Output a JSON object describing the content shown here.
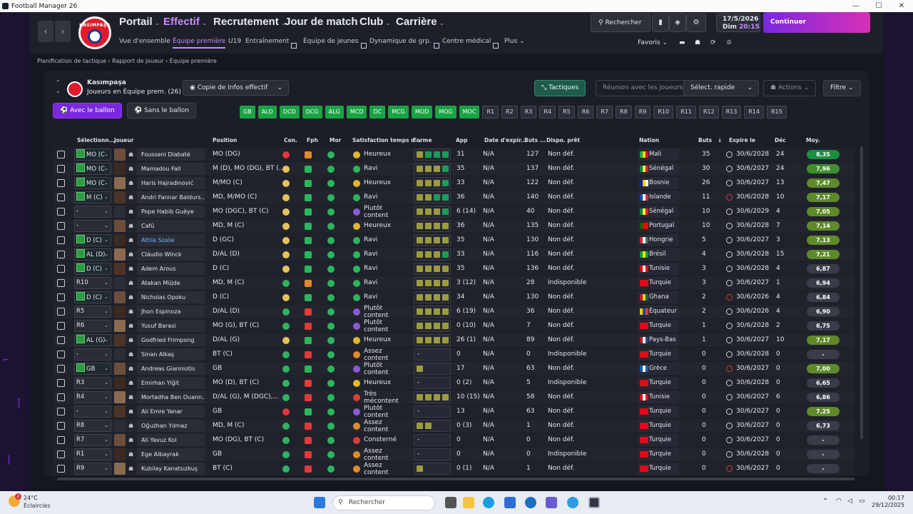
{
  "window": {
    "title": "Football Manager 26",
    "minimize": "—",
    "maximize": "☐",
    "close": "✕"
  },
  "nav": {
    "club": "KASIMPAŞA",
    "main": [
      {
        "label": "Portail",
        "active": false
      },
      {
        "label": "Effectif",
        "active": true
      },
      {
        "label": "Recrutement",
        "active": false
      },
      {
        "label": "Jour de match",
        "active": false
      },
      {
        "label": "Club",
        "active": false
      },
      {
        "label": "Carrière",
        "active": false
      }
    ],
    "sub": [
      "Vue d'ensemble",
      "Équipe première",
      "U19",
      "Entraînement",
      "Équipe de jeunes",
      "Dynamique de grp.",
      "Centre médical",
      "Plus"
    ],
    "search": "Rechercher",
    "date": "17/5/2026",
    "day": "Dim",
    "time": "20:15",
    "continue": "Continuer",
    "favoris": "Favoris"
  },
  "breadcrumb": {
    "items": [
      "Planification de tactique",
      "Rapport de joueur",
      "Équipe première"
    ]
  },
  "panel": {
    "team": "Kasımpaşa",
    "sub": "Joueurs en Équipe prem. (26)",
    "view": "Copie de Infos effectif",
    "with_ball": "Avec le ballon",
    "without_ball": "Sans le ballon",
    "tactiques": "Tactiques",
    "reunion": "Réunion avec les joueurs",
    "select_rapide": "Sélect. rapide",
    "actions": "Actions",
    "filtre": "Filtre",
    "pos_tags": [
      "GB",
      "ALD",
      "DCD",
      "DCG",
      "ALG",
      "MCD",
      "DC",
      "MCG",
      "MOD",
      "MOG",
      "MOC"
    ],
    "res_tags": [
      "R1",
      "R2",
      "R3",
      "R4",
      "R5",
      "R6",
      "R7",
      "R8",
      "R9",
      "R10",
      "R11",
      "R12",
      "R13",
      "R14",
      "R15"
    ]
  },
  "table": {
    "headers": [
      "Sélectionn...",
      "Joueur",
      "Position",
      "Con.",
      "Fph",
      "Mor",
      "Satisfaction temps d...",
      "Forme",
      "App",
      "Date d'expir...",
      "Buts ...",
      "Dispo. prêt",
      "Nation",
      "Buts",
      "Expire le",
      "Déc",
      "Moy."
    ],
    "rows": [
      {
        "sel": "MO (C",
        "pitch": true,
        "name": "Fousseni Diabaté",
        "pos": "MO (DG)",
        "con": "#e03a3a",
        "fph": "#e08a2a",
        "sat": "Heureux",
        "satc": "#e0b72a",
        "form": "yggg",
        "app": "31",
        "exp": "N/A",
        "buts1": "127",
        "dispo": "Non déf.",
        "flag": [
          "#14b53a",
          "#fcd116",
          "#ce1126"
        ],
        "nation": "Mali",
        "buts": "35",
        "clk": "n",
        "expire": "30/6/2028",
        "dec": "24",
        "moy": "8,35",
        "moyc": "#1a8f42"
      },
      {
        "sel": "MO (C",
        "pitch": true,
        "name": "Mamadou Fall",
        "pos": "M (D), MO (DG), BT (...",
        "con": "#e6c25a",
        "fph": "#2db55d",
        "sat": "Ravi",
        "satc": "#2db55d",
        "form": "yyyg",
        "app": "35",
        "exp": "N/A",
        "buts1": "137",
        "dispo": "Non déf.",
        "flag": [
          "#00853f",
          "#fdef42",
          "#e31b23"
        ],
        "nation": "Sénégal",
        "buts": "30",
        "clk": "n",
        "expire": "30/6/2027",
        "dec": "24",
        "moy": "7,96",
        "moyc": "#3f8f2e"
      },
      {
        "sel": "MO (C",
        "pitch": true,
        "name": "Haris Hajradinović",
        "pos": "M/MO (C)",
        "con": "#e6c25a",
        "fph": "#2db55d",
        "sat": "Heureux",
        "satc": "#e0b72a",
        "form": "yyyg",
        "app": "33",
        "exp": "N/A",
        "buts1": "122",
        "dispo": "Non déf.",
        "flag": [
          "#002395",
          "#fecb00",
          "#ffffff"
        ],
        "nation": "Bosnie",
        "buts": "26",
        "clk": "n",
        "expire": "30/6/2027",
        "dec": "13",
        "moy": "7,47",
        "moyc": "#5f8a2a"
      },
      {
        "sel": "M (C)",
        "pitch": true,
        "name": "Andri Fannar Baldurs...",
        "pos": "MD, M/MO (C)",
        "con": "#e6c25a",
        "fph": "#2db55d",
        "sat": "Ravi",
        "satc": "#2db55d",
        "form": "yygg",
        "app": "36",
        "exp": "N/A",
        "buts1": "140",
        "dispo": "Non déf.",
        "flag": [
          "#02529c",
          "#ffffff",
          "#dc1e35"
        ],
        "nation": "Islande",
        "buts": "11",
        "clk": "r",
        "expire": "30/6/2028",
        "dec": "10",
        "moy": "7,17",
        "moyc": "#5f8a2a"
      },
      {
        "sel": "-",
        "pitch": false,
        "name": "Pope Habib Guèye",
        "pos": "MO (DGC), BT (C)",
        "con": "#e6c25a",
        "fph": "#2db55d",
        "sat": "Plutôt content",
        "satc": "#8a5ad6",
        "form": "yyyg",
        "app": "6 (14)",
        "exp": "N/A",
        "buts1": "40",
        "dispo": "Non déf.",
        "flag": [
          "#00853f",
          "#fdef42",
          "#e31b23"
        ],
        "nation": "Sénégal",
        "buts": "10",
        "clk": "n",
        "expire": "30/6/2029",
        "dec": "4",
        "moy": "7,05",
        "moyc": "#5f8a2a"
      },
      {
        "sel": "-",
        "pitch": false,
        "name": "Cafú",
        "pos": "MD, M (C)",
        "con": "#e6c25a",
        "fph": "#2db55d",
        "sat": "Heureux",
        "satc": "#e0b72a",
        "form": "yyyy",
        "app": "36",
        "exp": "N/A",
        "buts1": "135",
        "dispo": "Non déf.",
        "flag": [
          "#006600",
          "#ff0000",
          "#ff0000"
        ],
        "nation": "Portugal",
        "buts": "10",
        "clk": "n",
        "expire": "30/6/2028",
        "dec": "7",
        "moy": "7,14",
        "moyc": "#5f8a2a"
      },
      {
        "sel": "D (C)",
        "pitch": true,
        "name": "Attila Szalai",
        "pos": "D (GC)",
        "link": true,
        "con": "#e6c25a",
        "fph": "#2db55d",
        "sat": "Ravi",
        "satc": "#2db55d",
        "form": "yyyy",
        "app": "35",
        "exp": "N/A",
        "buts1": "130",
        "dispo": "Non déf.",
        "flag": [
          "#cd2a3e",
          "#ffffff",
          "#436f4d"
        ],
        "nation": "Hongrie",
        "buts": "5",
        "clk": "n",
        "expire": "30/6/2027",
        "dec": "3",
        "moy": "7,13",
        "moyc": "#5f8a2a"
      },
      {
        "sel": "AL (D)",
        "pitch": true,
        "name": "Cláudio Winck",
        "pos": "D/AL (D)",
        "con": "#e6c25a",
        "fph": "#2db55d",
        "sat": "Ravi",
        "satc": "#2db55d",
        "form": "yyyg",
        "app": "33",
        "exp": "N/A",
        "buts1": "116",
        "dispo": "Non déf.",
        "flag": [
          "#009c3b",
          "#ffdf00",
          "#009c3b"
        ],
        "nation": "Brésil",
        "buts": "4",
        "clk": "n",
        "expire": "30/6/2028",
        "dec": "15",
        "moy": "7,21",
        "moyc": "#5f8a2a"
      },
      {
        "sel": "D (C)",
        "pitch": true,
        "name": "Adem Arous",
        "pos": "D (C)",
        "con": "#e6c25a",
        "fph": "#2db55d",
        "sat": "Ravi",
        "satc": "#2db55d",
        "form": "yyyy",
        "app": "35",
        "exp": "N/A",
        "buts1": "136",
        "dispo": "Non déf.",
        "flag": [
          "#e70013",
          "#ffffff",
          "#e70013"
        ],
        "nation": "Tunisie",
        "buts": "3",
        "clk": "n",
        "expire": "30/6/2028",
        "dec": "4",
        "moy": "6,87",
        "moyc": "#3a3d48"
      },
      {
        "sel": "R10",
        "pitch": false,
        "name": "Atakan Müjde",
        "pos": "MD, M (C)",
        "con": "#2db55d",
        "fph": "#e08a2a",
        "sat": "Ravi",
        "satc": "#2db55d",
        "form": "yyyy",
        "app": "3 (12)",
        "exp": "N/A",
        "buts1": "28",
        "dispo": "Indisponible",
        "flag": [
          "#e30a17",
          "#e30a17",
          "#e30a17"
        ],
        "nation": "Turquie",
        "buts": "3",
        "clk": "n",
        "expire": "30/6/2027",
        "dec": "1",
        "moy": "6,94",
        "moyc": "#3a3d48"
      },
      {
        "sel": "D (C)",
        "pitch": true,
        "name": "Nicholas Opoku",
        "pos": "D (C)",
        "con": "#e6c25a",
        "fph": "#2db55d",
        "sat": "Ravi",
        "satc": "#2db55d",
        "form": "yyyy",
        "app": "34",
        "exp": "N/A",
        "buts1": "130",
        "dispo": "Non déf.",
        "flag": [
          "#ce1126",
          "#fcd116",
          "#006b3f"
        ],
        "nation": "Ghana",
        "buts": "2",
        "clk": "r",
        "expire": "30/6/2026",
        "dec": "4",
        "moy": "6,84",
        "moyc": "#3a3d48"
      },
      {
        "sel": "R5",
        "pitch": false,
        "name": "Jhon Espinoza",
        "pos": "D/AL (D)",
        "con": "#2db55d",
        "fph": "#e03a3a",
        "sat": "Plutôt content",
        "satc": "#8a5ad6",
        "form": "yyyy",
        "app": "6 (19)",
        "exp": "N/A",
        "buts1": "36",
        "dispo": "Non déf.",
        "flag": [
          "#ffd100",
          "#034ea2",
          "#ef3340"
        ],
        "nation": "Équateur",
        "buts": "2",
        "clk": "n",
        "expire": "30/6/2026",
        "dec": "4",
        "moy": "6,90",
        "moyc": "#3a3d48"
      },
      {
        "sel": "R6",
        "pitch": false,
        "name": "Yusuf Barasi",
        "pos": "MO (G), BT (C)",
        "con": "#2db55d",
        "fph": "#e03a3a",
        "sat": "Plutôt content",
        "satc": "#8a5ad6",
        "form": "yyyy",
        "app": "0 (10)",
        "exp": "N/A",
        "buts1": "7",
        "dispo": "Non déf.",
        "flag": [
          "#e30a17",
          "#e30a17",
          "#e30a17"
        ],
        "nation": "Turquie",
        "buts": "1",
        "clk": "n",
        "expire": "30/6/2028",
        "dec": "2",
        "moy": "6,75",
        "moyc": "#3a3d48"
      },
      {
        "sel": "AL (G)",
        "pitch": true,
        "name": "Godfried Frimpong",
        "pos": "D/AL (G)",
        "con": "#e6c25a",
        "fph": "#2db55d",
        "sat": "Heureux",
        "satc": "#e0b72a",
        "form": "yyyy",
        "app": "26 (1)",
        "exp": "N/A",
        "buts1": "89",
        "dispo": "Non déf.",
        "flag": [
          "#ae1c28",
          "#ffffff",
          "#21468b"
        ],
        "nation": "Pays-Bas",
        "buts": "1",
        "clk": "n",
        "expire": "30/6/2027",
        "dec": "10",
        "moy": "7,17",
        "moyc": "#5f8a2a"
      },
      {
        "sel": "-",
        "pitch": false,
        "name": "Sinan Alkaş",
        "pos": "BT (C)",
        "con": "#2db55d",
        "fph": "#e03a3a",
        "sat": "Assez content",
        "satc": "#e08a2a",
        "form": "-",
        "app": "0",
        "exp": "N/A",
        "buts1": "0",
        "dispo": "Indisponible",
        "flag": [
          "#e30a17",
          "#e30a17",
          "#e30a17"
        ],
        "nation": "Turquie",
        "buts": "0",
        "clk": "n",
        "expire": "30/6/2028",
        "dec": "0",
        "moy": "-",
        "moyc": "#3a3d48"
      },
      {
        "sel": "GB",
        "pitch": true,
        "name": "Andreas Gianniotis",
        "pos": "GB",
        "con": "#2db55d",
        "fph": "#2db55d",
        "sat": "Plutôt content",
        "satc": "#8a5ad6",
        "form": "y",
        "app": "17",
        "exp": "N/A",
        "buts1": "63",
        "dispo": "Non déf.",
        "flag": [
          "#0d5eaf",
          "#ffffff",
          "#0d5eaf"
        ],
        "nation": "Grèce",
        "buts": "0",
        "clk": "r",
        "expire": "30/6/2027",
        "dec": "0",
        "moy": "7,00",
        "moyc": "#5f8a2a"
      },
      {
        "sel": "R3",
        "pitch": false,
        "name": "Emirhan Yiğit",
        "pos": "MO (D), BT (C)",
        "con": "#2db55d",
        "fph": "#e03a3a",
        "sat": "Heureux",
        "satc": "#e0b72a",
        "form": "-",
        "app": "0 (2)",
        "exp": "N/A",
        "buts1": "5",
        "dispo": "Indisponible",
        "flag": [
          "#e30a17",
          "#e30a17",
          "#e30a17"
        ],
        "nation": "Turquie",
        "buts": "0",
        "clk": "n",
        "expire": "30/6/2028",
        "dec": "0",
        "moy": "6,65",
        "moyc": "#3a3d48"
      },
      {
        "sel": "R4",
        "pitch": false,
        "name": "Mortadha Ben Ouann...",
        "pos": "D/AL (G), M (DGC),...",
        "con": "#2db55d",
        "fph": "#e03a3a",
        "sat": "Très mécontent",
        "satc": "#e03a3a",
        "form": "yyyy",
        "app": "10 (15)",
        "exp": "N/A",
        "buts1": "58",
        "dispo": "Non déf.",
        "flag": [
          "#e70013",
          "#ffffff",
          "#e70013"
        ],
        "nation": "Tunisie",
        "buts": "0",
        "clk": "n",
        "expire": "30/6/2027",
        "dec": "6",
        "moy": "6,86",
        "moyc": "#3a3d48"
      },
      {
        "sel": "-",
        "pitch": false,
        "name": "Ali Emre Yanar",
        "pos": "GB",
        "con": "#e03a3a",
        "fph": "#2db55d",
        "sat": "Plutôt content",
        "satc": "#8a5ad6",
        "form": "-",
        "app": "13",
        "exp": "N/A",
        "buts1": "63",
        "dispo": "Non déf.",
        "flag": [
          "#e30a17",
          "#e30a17",
          "#e30a17"
        ],
        "nation": "Turquie",
        "buts": "0",
        "clk": "n",
        "expire": "30/6/2027",
        "dec": "0",
        "moy": "7,25",
        "moyc": "#5f8a2a"
      },
      {
        "sel": "R8",
        "pitch": false,
        "name": "Oğuzhan Yılmaz",
        "pos": "MD, M (C)",
        "con": "#2db55d",
        "fph": "#e03a3a",
        "sat": "Assez content",
        "satc": "#e08a2a",
        "form": "yy",
        "app": "0 (3)",
        "exp": "N/A",
        "buts1": "1",
        "dispo": "Non déf.",
        "flag": [
          "#e30a17",
          "#e30a17",
          "#e30a17"
        ],
        "nation": "Turquie",
        "buts": "0",
        "clk": "n",
        "expire": "30/6/2027",
        "dec": "0",
        "moy": "6,73",
        "moyc": "#3a3d48"
      },
      {
        "sel": "R7",
        "pitch": false,
        "name": "Ali Yavuz Kol",
        "pos": "MO (DG), BT (C)",
        "con": "#2db55d",
        "fph": "#e03a3a",
        "sat": "Consterné",
        "satc": "#e03a3a",
        "form": "-",
        "app": "0",
        "exp": "N/A",
        "buts1": "0",
        "dispo": "Non déf.",
        "flag": [
          "#e30a17",
          "#e30a17",
          "#e30a17"
        ],
        "nation": "Turquie",
        "buts": "0",
        "clk": "n",
        "expire": "30/6/2027",
        "dec": "0",
        "moy": "-",
        "moyc": "#3a3d48"
      },
      {
        "sel": "R1",
        "pitch": false,
        "name": "Ege Albayrak",
        "pos": "GB",
        "con": "#2db55d",
        "fph": "#e03a3a",
        "sat": "Assez content",
        "satc": "#e08a2a",
        "form": "-",
        "app": "0",
        "exp": "N/A",
        "buts1": "0",
        "dispo": "Indisponible",
        "flag": [
          "#e30a17",
          "#e30a17",
          "#e30a17"
        ],
        "nation": "Turquie",
        "buts": "0",
        "clk": "n",
        "expire": "30/6/2028",
        "dec": "0",
        "moy": "-",
        "moyc": "#3a3d48"
      },
      {
        "sel": "R9",
        "pitch": false,
        "name": "Kubilay Kanatsızkuş",
        "pos": "BT (C)",
        "con": "#2db55d",
        "fph": "#e03a3a",
        "sat": "Assez content",
        "satc": "#e08a2a",
        "form": "y",
        "app": "0 (1)",
        "exp": "N/A",
        "buts1": "1",
        "dispo": "Non déf.",
        "flag": [
          "#e30a17",
          "#e30a17",
          "#e30a17"
        ],
        "nation": "Turquie",
        "buts": "0",
        "clk": "r",
        "expire": "30/6/2027",
        "dec": "0",
        "moy": "-",
        "moyc": "#3a3d48"
      }
    ]
  },
  "taskbar": {
    "temp": "24°C",
    "weather": "Éclaircies",
    "search": "Rechercher",
    "time": "00:17",
    "date": "29/12/2025",
    "badge": "2"
  }
}
